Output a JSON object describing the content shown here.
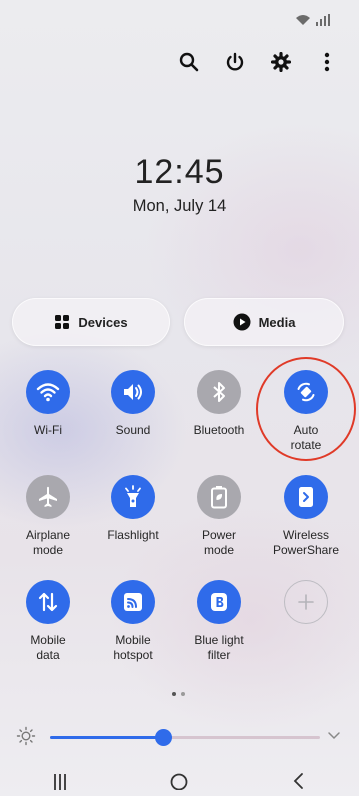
{
  "status_bar": {
    "icons": [
      "wifi-icon",
      "signal-icon"
    ]
  },
  "top_actions": [
    "search-icon",
    "power-icon",
    "settings-icon",
    "more-options-icon"
  ],
  "clock": {
    "time": "12:45",
    "date": "Mon, July 14"
  },
  "quick_buttons": {
    "devices_label": "Devices",
    "media_label": "Media"
  },
  "tiles": [
    {
      "label": "Wi-Fi",
      "icon": "wifi-icon",
      "state": "on"
    },
    {
      "label": "Sound",
      "icon": "volume-icon",
      "state": "on"
    },
    {
      "label": "Bluetooth",
      "icon": "bluetooth-icon",
      "state": "off"
    },
    {
      "label": "Auto\nrotate",
      "icon": "auto-rotate-icon",
      "state": "on",
      "highlighted": true
    },
    {
      "label": "Airplane\nmode",
      "icon": "airplane-icon",
      "state": "off"
    },
    {
      "label": "Flashlight",
      "icon": "flashlight-icon",
      "state": "on"
    },
    {
      "label": "Power\nmode",
      "icon": "battery-saver-icon",
      "state": "off"
    },
    {
      "label": "Wireless\nPowerShare",
      "icon": "wireless-powershare-icon",
      "state": "on"
    },
    {
      "label": "Mobile\ndata",
      "icon": "mobile-data-icon",
      "state": "on"
    },
    {
      "label": "Mobile\nhotspot",
      "icon": "hotspot-icon",
      "state": "on"
    },
    {
      "label": "Blue light\nfilter",
      "icon": "blue-light-filter-icon",
      "state": "on"
    },
    {
      "label": "",
      "icon": "add-icon",
      "state": "add"
    }
  ],
  "pages": {
    "count": 2,
    "current": 1
  },
  "brightness": {
    "level": 0.42
  },
  "nav_bar": [
    "recents-icon",
    "home-icon",
    "back-icon"
  ],
  "colors": {
    "accent": "#2f6bea",
    "tile_off": "#a9a8ae",
    "highlight_ring": "#e03a28"
  }
}
